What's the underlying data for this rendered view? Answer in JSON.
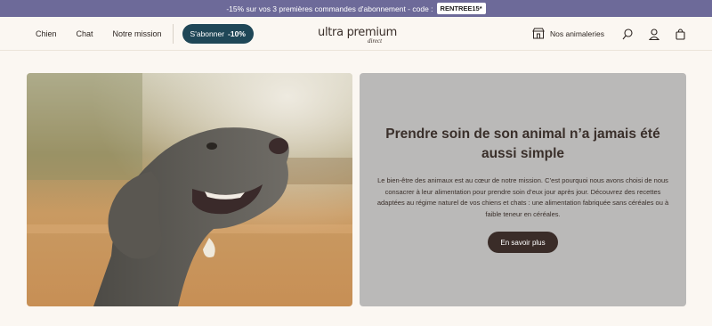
{
  "promo": {
    "text": "-15% sur vos 3 premières commandes d'abonnement - code :",
    "code": "RENTREE15*"
  },
  "nav": {
    "items": [
      "Chien",
      "Chat",
      "Notre mission"
    ],
    "subscribe_label": "S'abonner",
    "subscribe_discount": "-10%"
  },
  "logo": {
    "main": "ultra premium",
    "sub": "direct"
  },
  "header_right": {
    "stores_label": "Nos animaleries",
    "icons": [
      "store-icon",
      "search-icon",
      "account-icon",
      "cart-icon"
    ]
  },
  "hero": {
    "title": "Prendre soin de son animal n’a jamais été aussi simple",
    "text": "Le bien-être des animaux est au cœur de notre mission. C’est pourquoi nous avons choisi de nous consacrer à leur alimentation pour prendre soin d’eux jour après jour. Découvrez des recettes adaptées au régime naturel de vos chiens et chats : une alimentation fabriquée sans céréales ou à faible teneur en céréales.",
    "button_label": "En savoir plus"
  },
  "colors": {
    "promo_bar": "#6d6a99",
    "subscribe_button": "#1f4757",
    "hero_card": "#bab9b8",
    "hero_button": "#3a2c28",
    "page_bg": "#fbf7f2"
  }
}
